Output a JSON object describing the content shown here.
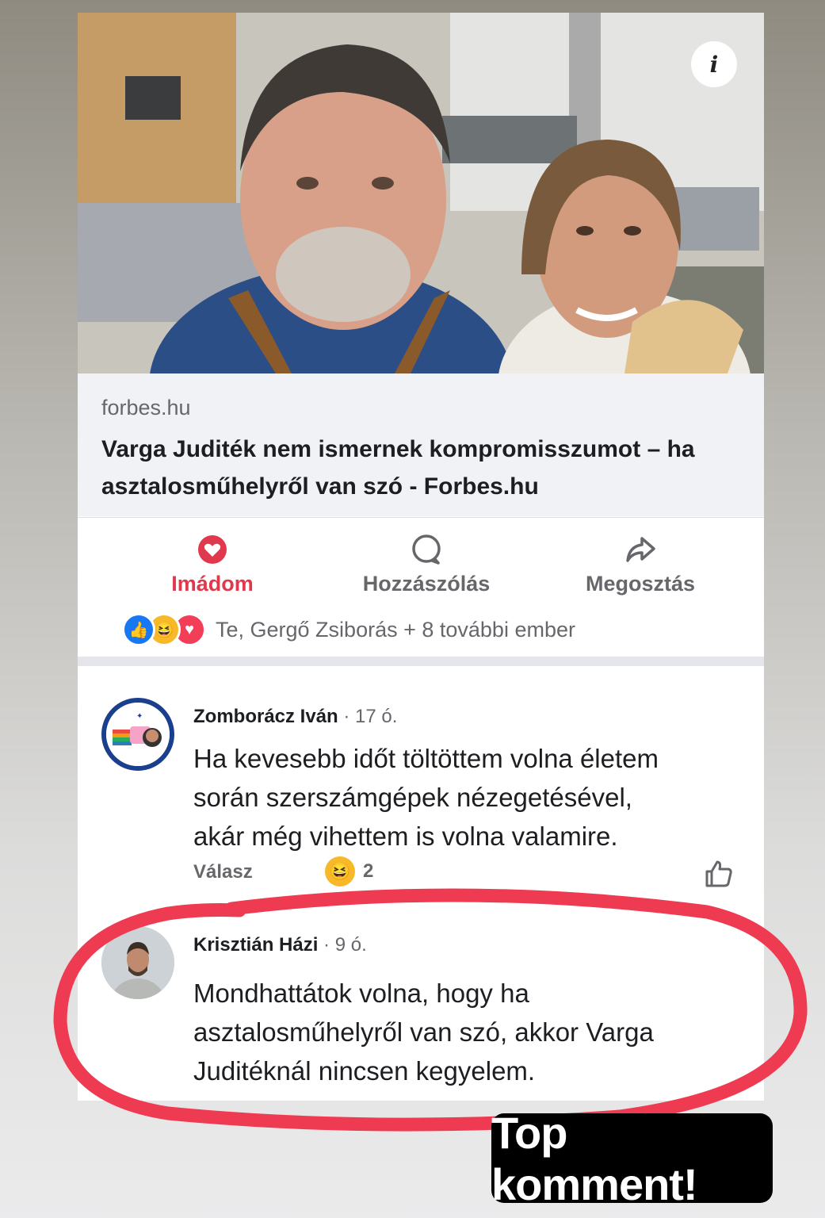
{
  "post": {
    "link": {
      "domain": "forbes.hu",
      "headline": "Varga Juditék nem ismernek kompromisszumot – ha asztalosműhelyről van szó - Forbes.hu"
    },
    "info_label": "i",
    "actions": {
      "love_label": "Imádom",
      "comment_label": "Hozzászólás",
      "share_label": "Megosztás"
    },
    "reactions": {
      "summary": "Te, Gergő Zsiborás + 8 további ember"
    },
    "comments": [
      {
        "author": "Zomborácz Iván",
        "time": "· 17 ó.",
        "text_lines": [
          "Ha kevesebb időt töltöttem volna életem",
          "során szerszámgépek nézegetésével,",
          "akár még vihettem is volna valamire."
        ],
        "reply_label": "Válasz",
        "reaction_count": "2"
      },
      {
        "author": "Krisztián Házi",
        "time": "· 9 ó.",
        "text_lines": [
          "Mondhattátok volna, hogy ha",
          "asztalosműhelyről van szó, akkor Varga",
          "Juditéknál nincsen kegyelem."
        ]
      }
    ]
  },
  "badge": {
    "text": "Top komment!"
  },
  "colors": {
    "love_red": "#e0394d",
    "highlight_red": "#ef3b52",
    "muted_text": "#65676b",
    "link_bg": "#f0f2f5"
  },
  "icons": [
    "info-icon",
    "heart-icon",
    "comment-bubble-icon",
    "share-arrow-icon",
    "like-reaction-icon",
    "haha-reaction-icon",
    "love-reaction-icon",
    "thumbs-up-icon"
  ]
}
